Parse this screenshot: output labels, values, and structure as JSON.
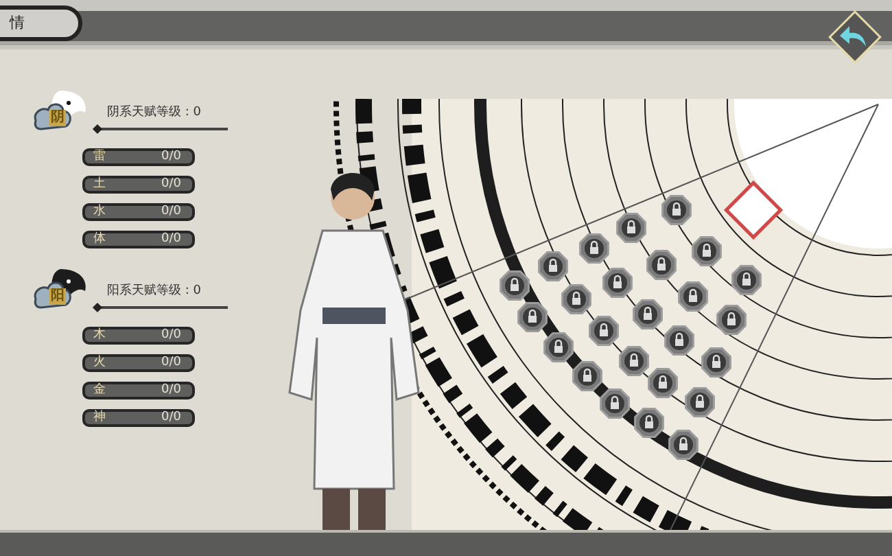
{
  "top_tab": {
    "label": "情"
  },
  "groups": [
    {
      "kind": "yin",
      "emblem": "阴",
      "title": "阴系天赋等级 : 0",
      "stats": [
        {
          "label": "雷",
          "value": "0/0"
        },
        {
          "label": "土",
          "value": "0/0"
        },
        {
          "label": "水",
          "value": "0/0"
        },
        {
          "label": "体",
          "value": "0/0"
        }
      ]
    },
    {
      "kind": "yang",
      "emblem": "阳",
      "title": "阳系天赋等级 : 0",
      "stats": [
        {
          "label": "木",
          "value": "0/0"
        },
        {
          "label": "火",
          "value": "0/0"
        },
        {
          "label": "金",
          "value": "0/0"
        },
        {
          "label": "神",
          "value": "0/0"
        }
      ]
    }
  ]
}
